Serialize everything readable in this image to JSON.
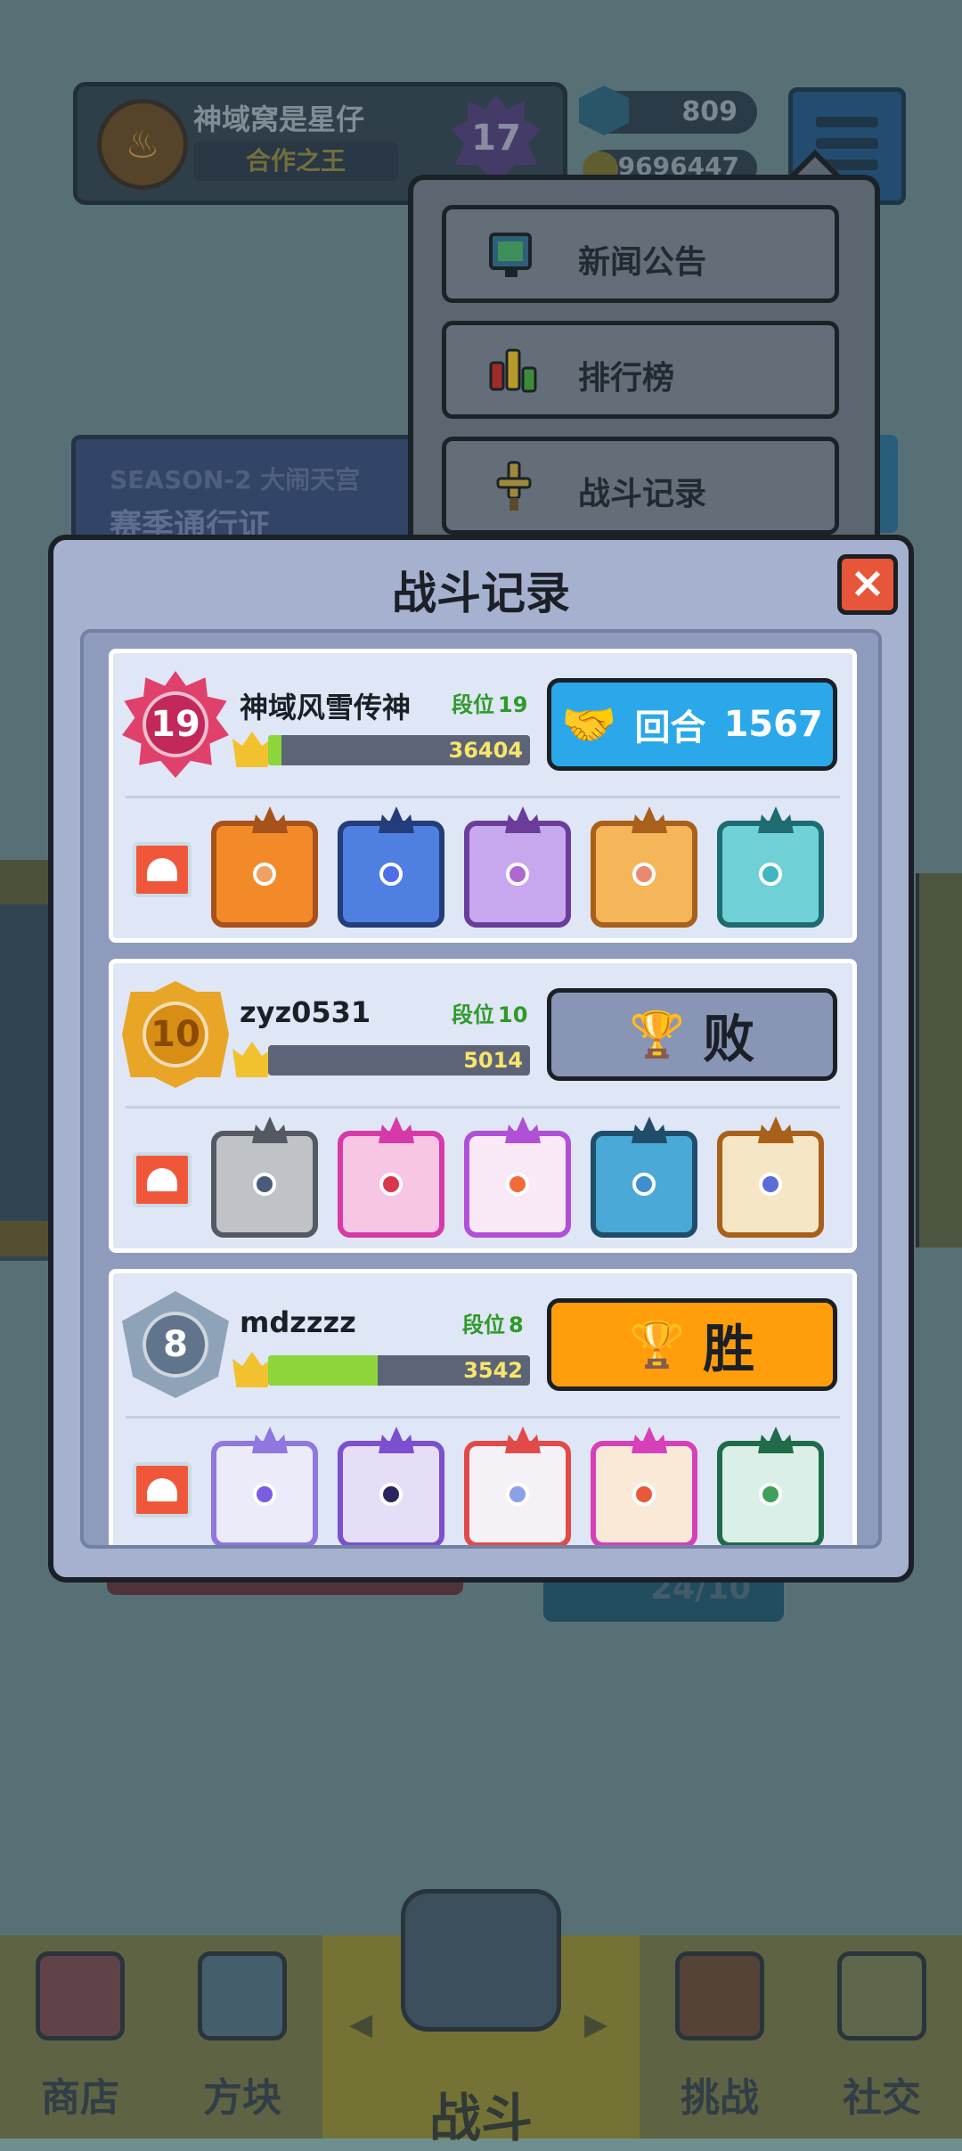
{
  "top_bar": {
    "player_name": "神域窝是星仔",
    "player_title": "合作之王",
    "level": "17",
    "gems": "809",
    "coins": "39696447"
  },
  "season_banner": {
    "season": "SEASON-2 大闹天宫",
    "title": "赛季通行证"
  },
  "background": {
    "counter": "24/10"
  },
  "dropdown_menu": {
    "items": [
      {
        "label": "新闻公告",
        "icon": "monitor-icon"
      },
      {
        "label": "排行榜",
        "icon": "leaderboard-icon"
      },
      {
        "label": "战斗记录",
        "icon": "sword-icon"
      }
    ]
  },
  "modal": {
    "title": "战斗记录",
    "close_label": "×",
    "tier_label": "段位",
    "records": [
      {
        "rank": "19",
        "player_name": "神域风雪传神",
        "tier": "19",
        "score": "36404",
        "score_fill": 0.05,
        "result_type": "round",
        "result_label": "回合",
        "round_count": "1567",
        "dice": [
          {
            "name": "sun-dice",
            "border": "#a8521b",
            "fill": "#f38a2a",
            "pip": "#f0a060"
          },
          {
            "name": "moon-dice",
            "border": "#233d7a",
            "fill": "#4f7fe0",
            "pip": "#4d6ee6"
          },
          {
            "name": "star-dice",
            "border": "#6b3d9a",
            "fill": "#c7a8ef",
            "pip": "#b067d0"
          },
          {
            "name": "heart-dice",
            "border": "#a8601b",
            "fill": "#f5b65a",
            "pip": "#e88a70"
          },
          {
            "name": "ice-dice",
            "border": "#1f6b72",
            "fill": "#6fd1d6",
            "pip": "#3fb6c0"
          }
        ]
      },
      {
        "rank": "10",
        "player_name": "zyz0531",
        "tier": "10",
        "score": "5014",
        "score_fill": 0.0,
        "result_type": "lose",
        "result_label": "败",
        "dice": [
          {
            "name": "gear-dice",
            "border": "#555a62",
            "fill": "#bfc2c7",
            "pip": "#4a5a7a"
          },
          {
            "name": "shield-dice",
            "border": "#d63aa8",
            "fill": "#f6c6e3",
            "pip": "#d7384e"
          },
          {
            "name": "light-dice",
            "border": "#b050d6",
            "fill": "#f9e8f5",
            "pip": "#f26b3a"
          },
          {
            "name": "wind-dice",
            "border": "#1f4d6a",
            "fill": "#4aa9d6",
            "pip": "#3f8fd0"
          },
          {
            "name": "infinity-dice",
            "border": "#a8601b",
            "fill": "#f5e6c5",
            "pip": "#5d6bd8"
          }
        ]
      },
      {
        "rank": "8",
        "player_name": "mdzzzz",
        "tier": "8",
        "score": "3542",
        "score_fill": 0.42,
        "result_type": "win",
        "result_label": "胜",
        "dice": [
          {
            "name": "mystery-dice",
            "border": "#8f76e0",
            "fill": "#ecebfa",
            "pip": "#7a5de0"
          },
          {
            "name": "thunder-dice",
            "border": "#7b4fd0",
            "fill": "#e6def7",
            "pip": "#2a2460"
          },
          {
            "name": "rainbow-dice",
            "border": "#e24a4a",
            "fill": "#f4f2f7",
            "pip": "#8aa0e8"
          },
          {
            "name": "sunburst-dice",
            "border": "#d640b8",
            "fill": "#fbe9d8",
            "pip": "#e8593a"
          },
          {
            "name": "pentagram-dice",
            "border": "#1f6b4a",
            "fill": "#d9efe7",
            "pip": "#3fa05c"
          }
        ]
      }
    ]
  },
  "bottom_nav": {
    "items": [
      {
        "label": "商店",
        "icon": "shop-icon"
      },
      {
        "label": "方块",
        "icon": "dice-box-icon"
      },
      {
        "label": "战斗",
        "icon": "battle-icon"
      },
      {
        "label": "挑战",
        "icon": "challenge-icon"
      },
      {
        "label": "社交",
        "icon": "social-icon"
      }
    ],
    "left_arrow": "◀",
    "right_arrow": "▶"
  }
}
